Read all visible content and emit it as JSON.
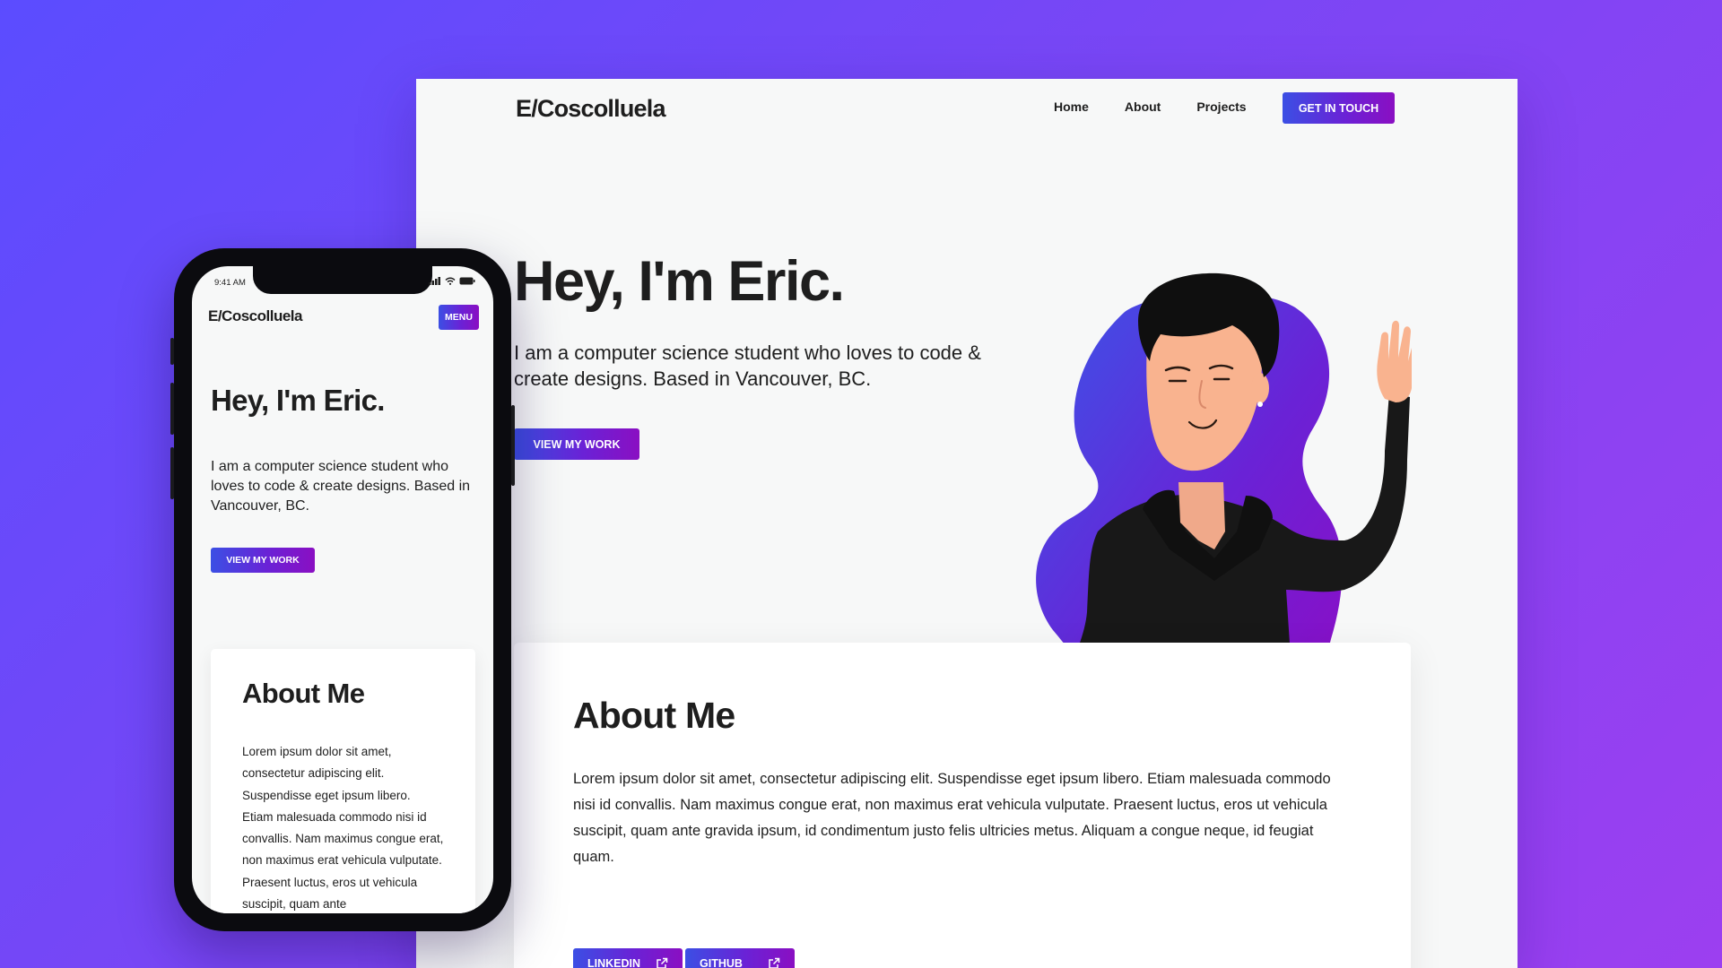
{
  "desktop": {
    "logo": "E/Coscolluela",
    "nav": {
      "links": [
        "Home",
        "About",
        "Projects"
      ],
      "cta": "GET IN TOUCH"
    },
    "hero": {
      "title": "Hey, I'm Eric.",
      "subtitle": "I am a computer science student who loves to code & create designs. Based in Vancouver, BC.",
      "button": "VIEW MY WORK"
    },
    "about": {
      "title": "About Me",
      "text": "Lorem ipsum dolor sit amet, consectetur adipiscing elit. Suspendisse eget ipsum libero. Etiam malesuada commodo nisi id convallis. Nam maximus congue erat, non maximus erat vehicula vulputate. Praesent luctus, eros ut vehicula suscipit, quam ante gravida ipsum, id condimentum justo felis ultricies metus. Aliquam a congue neque, id feugiat quam.",
      "social": [
        {
          "label": "LINKEDIN",
          "icon": "external-link-icon"
        },
        {
          "label": "GITHUB",
          "icon": "external-link-icon"
        }
      ]
    }
  },
  "mobile": {
    "status_time": "9:41 AM",
    "logo": "E/Coscolluela",
    "menu": "MENU",
    "hero": {
      "title": "Hey, I'm Eric.",
      "subtitle": "I am a computer science student who loves to code & create designs. Based in Vancouver, BC.",
      "button": "VIEW MY WORK"
    },
    "about": {
      "title": "About Me",
      "text": "Lorem ipsum dolor sit amet, consectetur adipiscing elit. Suspendisse eget ipsum libero. Etiam malesuada commodo nisi id convallis. Nam maximus congue erat, non maximus erat vehicula vulputate. Praesent luctus, eros ut vehicula suscipit, quam ante"
    }
  },
  "colors": {
    "background_start": "#5b4cff",
    "background_end": "#9c3ff0",
    "button_gradient_start": "#3b4fe4",
    "button_gradient_end": "#8a0fc2",
    "text": "#1e1e1e"
  }
}
